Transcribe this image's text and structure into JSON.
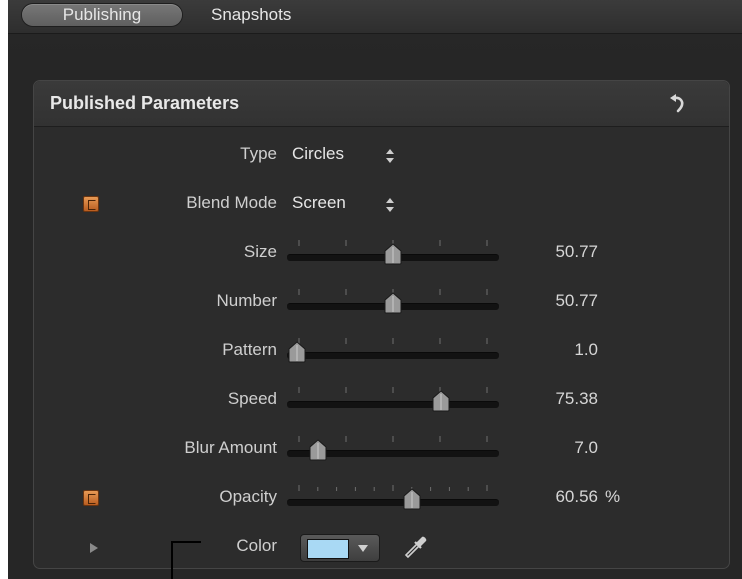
{
  "tabs": {
    "publishing": "Publishing",
    "snapshots": "Snapshots"
  },
  "panel": {
    "title": "Published Parameters",
    "reset_icon": "reset-arrow-icon"
  },
  "params": {
    "type": {
      "label": "Type",
      "value": "Circles"
    },
    "blend_mode": {
      "label": "Blend Mode",
      "value": "Screen",
      "rig_badge": "R"
    },
    "size": {
      "label": "Size",
      "value": "50.77",
      "fraction": 0.5
    },
    "number": {
      "label": "Number",
      "value": "50.77",
      "fraction": 0.5
    },
    "pattern": {
      "label": "Pattern",
      "value": "1.0",
      "fraction": 0.0
    },
    "speed": {
      "label": "Speed",
      "value": "75.38",
      "fraction": 0.75
    },
    "blur_amount": {
      "label": "Blur Amount",
      "value": "7.0",
      "fraction": 0.11
    },
    "opacity": {
      "label": "Opacity",
      "value": "60.56",
      "unit": "%",
      "fraction": 0.6,
      "rig_badge": "R"
    },
    "color": {
      "label": "Color",
      "swatch_color": "#a9d9f4"
    }
  },
  "colors": {
    "window_bg": "#262626",
    "panel_bg": "#2c2c2c",
    "rig_badge": "#d47a35",
    "thumb": "#9a9a9a"
  }
}
